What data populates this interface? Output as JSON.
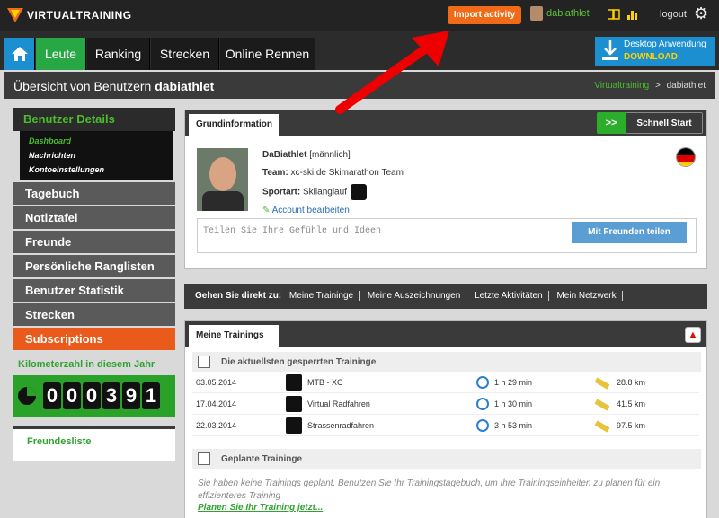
{
  "header": {
    "logo_text": "VIRTUALTRAINING",
    "import_label": "Import activity",
    "username": "dabiathlet",
    "logout_label": "logout"
  },
  "nav": {
    "items": [
      "Leute",
      "Ranking",
      "Strecken",
      "Online Rennen"
    ],
    "desktop_line1": "Desktop Anwendung",
    "desktop_line2": "DOWNLOAD"
  },
  "titlebar": {
    "prefix": "Übersicht von Benutzern ",
    "user": "dabiathlet",
    "crumb_root": "Virtualtraining",
    "crumb_sep": ">",
    "crumb_user": "dabiathlet"
  },
  "sidebar": {
    "header": "Benutzer Details",
    "sub": [
      "Dashboard",
      "Nachrichten",
      "Kontoeinstellungen"
    ],
    "items": [
      "Tagebuch",
      "Notiztafel",
      "Freunde",
      "Persönliche Ranglisten",
      "Benutzer Statistik",
      "Strecken",
      "Subscriptions"
    ],
    "km_title": "Kilometerzahl in diesem Jahr",
    "km_digits": [
      "0",
      "0",
      "0",
      "3",
      "9",
      "1"
    ],
    "friends_label": "Freundesliste"
  },
  "grund": {
    "tab": "Grundinformation",
    "schnell_icon": ">>",
    "schnell_label": "Schnell Start",
    "name": "DaBiathlet",
    "gender": "[männlich]",
    "team_label": "Team:",
    "team_value": "xc-ski.de Skimarathon Team",
    "sport_label": "Sportart:",
    "sport_value": "Skilanglauf",
    "edit_label": "Account bearbeiten",
    "share_placeholder": "Teilen Sie Ihre Gefühle und Ideen",
    "share_button": "Mit Freunden teilen"
  },
  "goto": {
    "label": "Gehen Sie direkt zu:",
    "links": [
      "Meine Traininge",
      "Meine Auszeichnungen",
      "Letzte Aktivitäten",
      "Mein Netzwerk"
    ]
  },
  "trainings": {
    "tab": "Meine Trainings",
    "recent_header": "Die aktuellsten gesperrten Traininge",
    "rows": [
      {
        "date": "03.05.2014",
        "type": "MTB - XC",
        "duration": "1 h 29 min",
        "distance": "28.8 km"
      },
      {
        "date": "17.04.2014",
        "type": "Virtual Radfahren",
        "duration": "1 h 30 min",
        "distance": "41.5 km"
      },
      {
        "date": "22.03.2014",
        "type": "Strassenradfahren",
        "duration": "3 h 53 min",
        "distance": "97.5 km"
      }
    ],
    "planned_header": "Geplante Traininge",
    "no_plan_text": "Sie haben keine Trainings geplant. Benutzen Sie Ihr Trainingstagebuch, um Ihre Trainingseinheiten zu planen für ein effizienteres Training",
    "plan_link": "Planen Sie Ihr Training jetzt..."
  },
  "colors": {
    "accent_green": "#28a745",
    "orange": "#f06a17",
    "blue": "#1b8fcf"
  }
}
